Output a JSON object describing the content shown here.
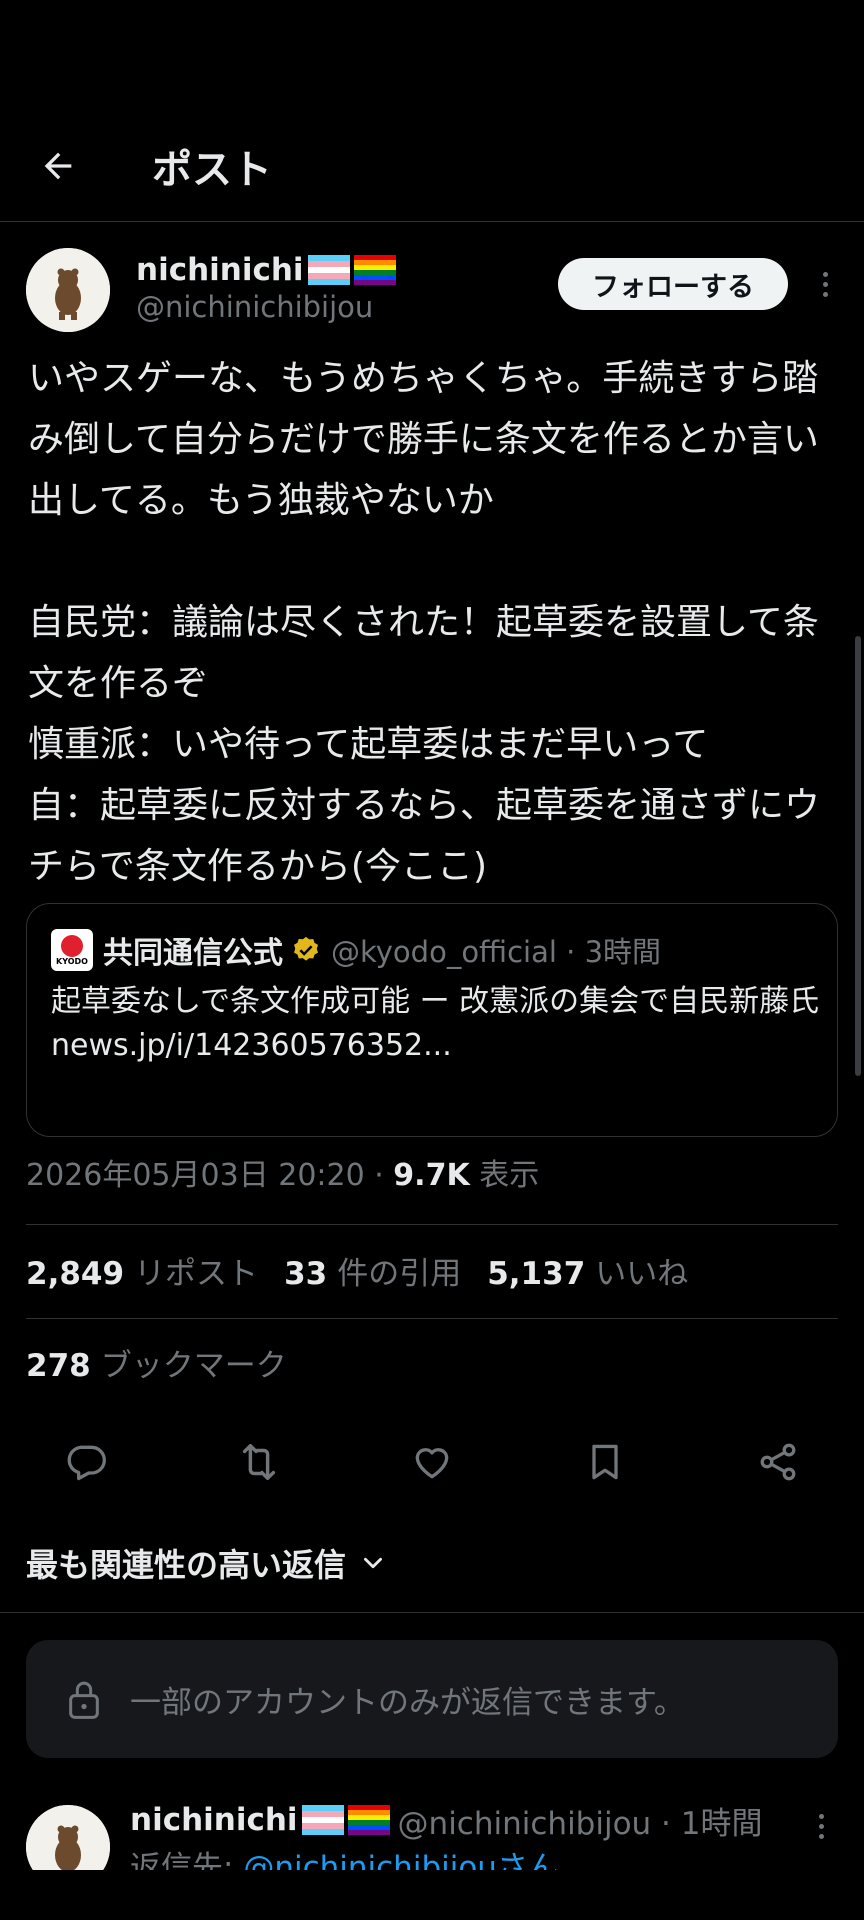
{
  "header": {
    "title": "ポスト",
    "back_icon": "arrow-left-icon"
  },
  "author": {
    "name": "nichinichi",
    "flags": [
      "transgender-flag",
      "rainbow-flag"
    ],
    "handle": "@nichinichibijou",
    "follow_label": "フォローする"
  },
  "post": {
    "text": "いやスゲーな、もうめちゃくちゃ。手続きすら踏み倒して自分らだけで勝手に条文を作るとか言い出してる。もう独裁やないか\n\n自民党：議論は尽くされた！起草委を設置して条文を作るぞ\n慎重派：いや待って起草委はまだ早いって\n自：起草委に反対するなら、起草委を通さずにウチらで条文作るから(今ここ)"
  },
  "quote": {
    "logo_text": "KYODO",
    "name": "共同通信公式",
    "handle_time": "@kyodo_official · 3時間",
    "text": "起草委なしで条文作成可能 ー 改憲派の集会で自民新藤氏",
    "link": "news.jp/i/142360576352..."
  },
  "meta": {
    "datetime": "2026年05月03日 20:20 · ",
    "views": "9.7K",
    "views_label": " 表示"
  },
  "stats": {
    "reposts": "2,849",
    "reposts_label": "リポスト",
    "quotes": "33",
    "quotes_label": "件の引用",
    "likes": "5,137",
    "likes_label": "いいね",
    "bookmarks": "278",
    "bookmarks_label": "ブックマーク"
  },
  "actions": [
    "reply-icon",
    "repost-icon",
    "like-icon",
    "bookmark-icon",
    "share-icon"
  ],
  "sort": {
    "label": "最も関連性の高い返信"
  },
  "restrict": {
    "message": "一部のアカウントのみが返信できます。"
  },
  "reply": {
    "name": "nichinichi",
    "meta": "@nichinichibijou · 1時間",
    "reply_to_prefix": "返信先: ",
    "reply_to_link": "@nichinichibijouさん"
  },
  "colors": {
    "accent": "#1d9bf0",
    "muted": "#71767b",
    "background": "#000000",
    "verified": "#e2b719"
  }
}
